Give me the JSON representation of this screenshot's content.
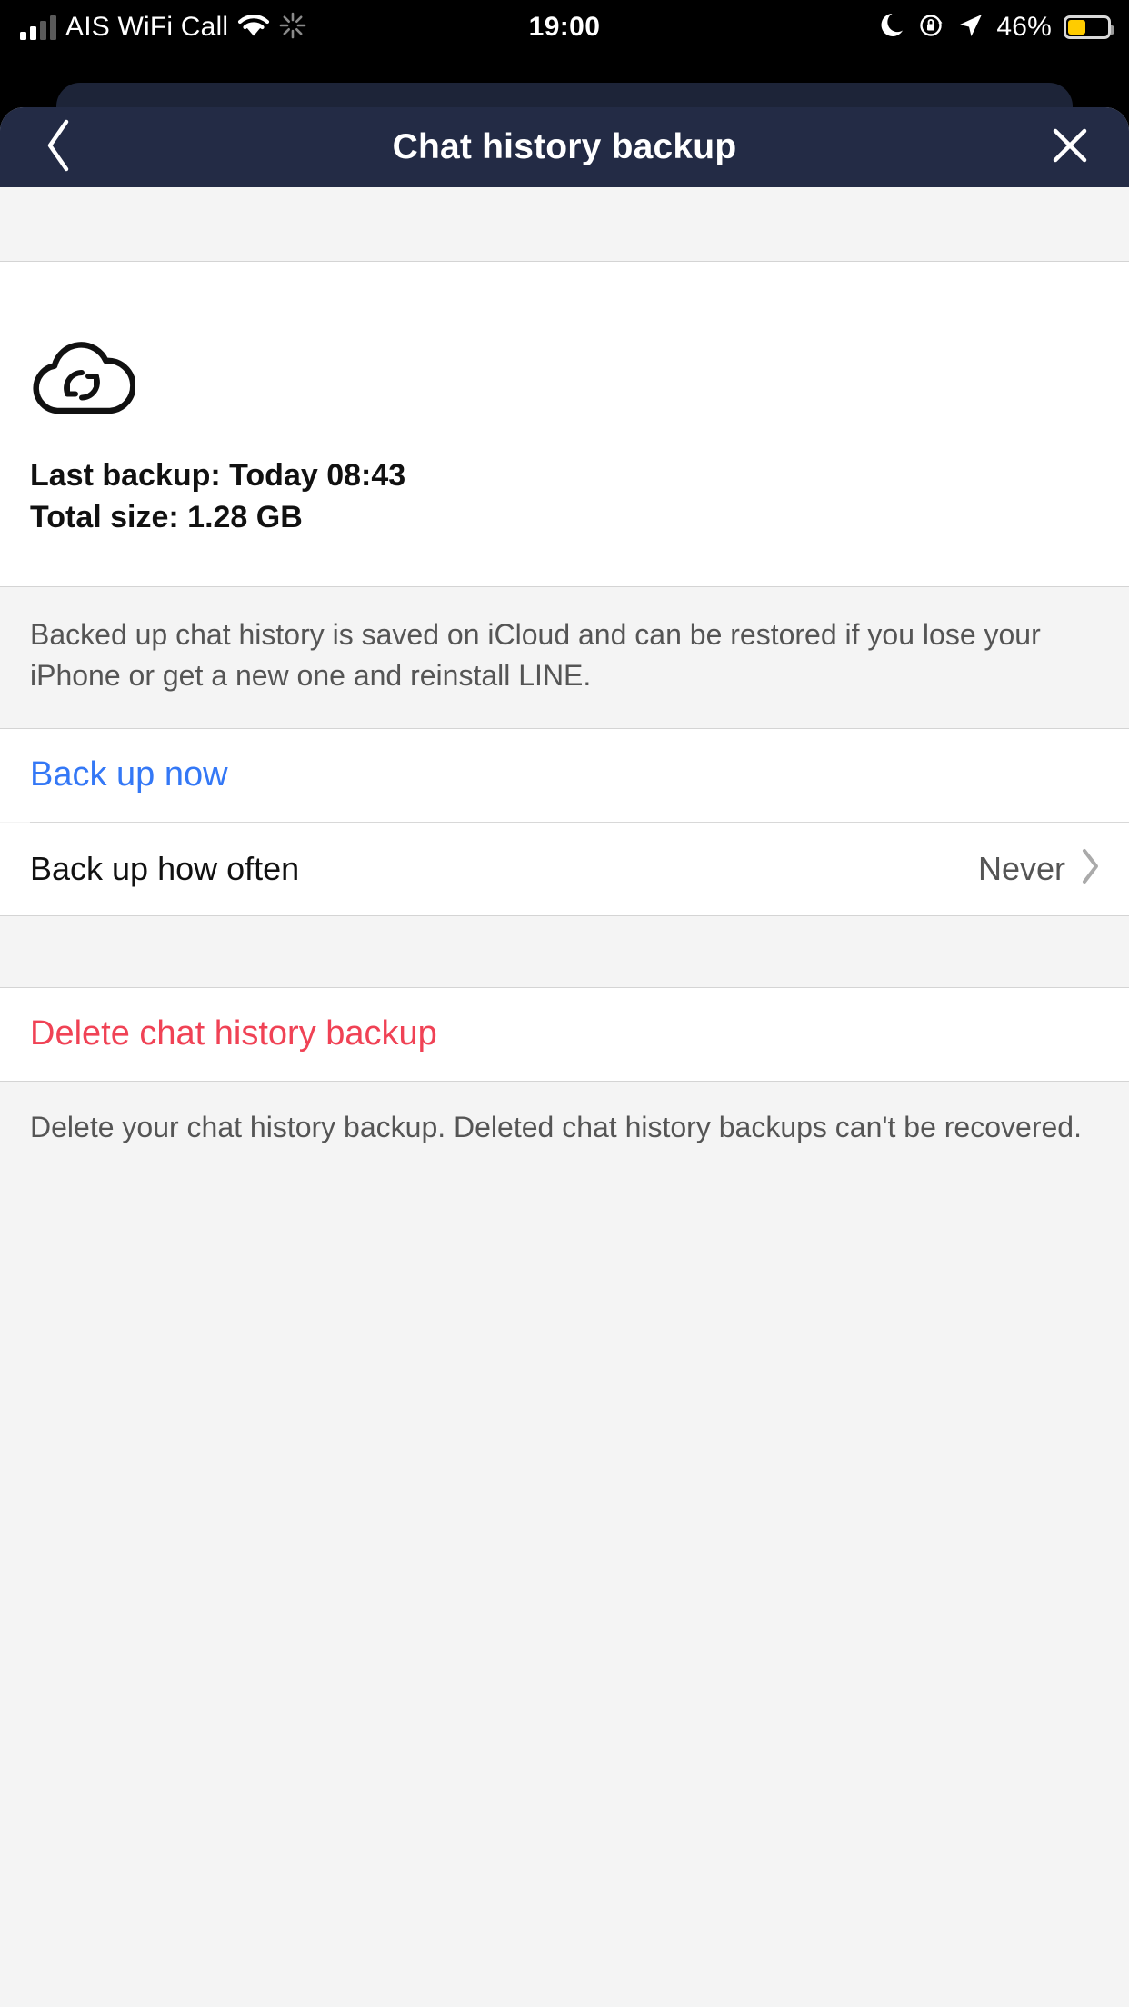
{
  "statusbar": {
    "carrier": "AIS WiFi Call",
    "time": "19:00",
    "battery_percent": "46%",
    "icons": {
      "signal": "signal-bars-icon",
      "wifi": "wifi-icon",
      "sync": "activity-spinner-icon",
      "dnd": "moon-icon",
      "rotation_lock": "rotation-lock-icon",
      "location": "location-arrow-icon",
      "battery": "battery-icon"
    },
    "battery_fill_color": "#FFCC00"
  },
  "navbar": {
    "title": "Chat history backup",
    "back_icon": "chevron-left-icon",
    "close_icon": "close-icon",
    "background_color": "#232B45"
  },
  "backup_info": {
    "cloud_icon": "cloud-sync-icon",
    "last_backup": "Last backup: Today 08:43",
    "total_size": "Total size: 1.28 GB"
  },
  "note": {
    "text": "Backed up chat history is saved on iCloud and can be restored if you lose your iPhone or get a new one and reinstall LINE."
  },
  "actions": {
    "back_up_now": "Back up now",
    "back_up_now_color": "#3478F6",
    "frequency_label": "Back up how often",
    "frequency_value": "Never",
    "frequency_chevron": "chevron-right-icon"
  },
  "delete": {
    "label": "Delete chat history backup",
    "color": "#F04255",
    "footnote": "Delete your chat history backup. Deleted chat history backups can't be recovered."
  }
}
